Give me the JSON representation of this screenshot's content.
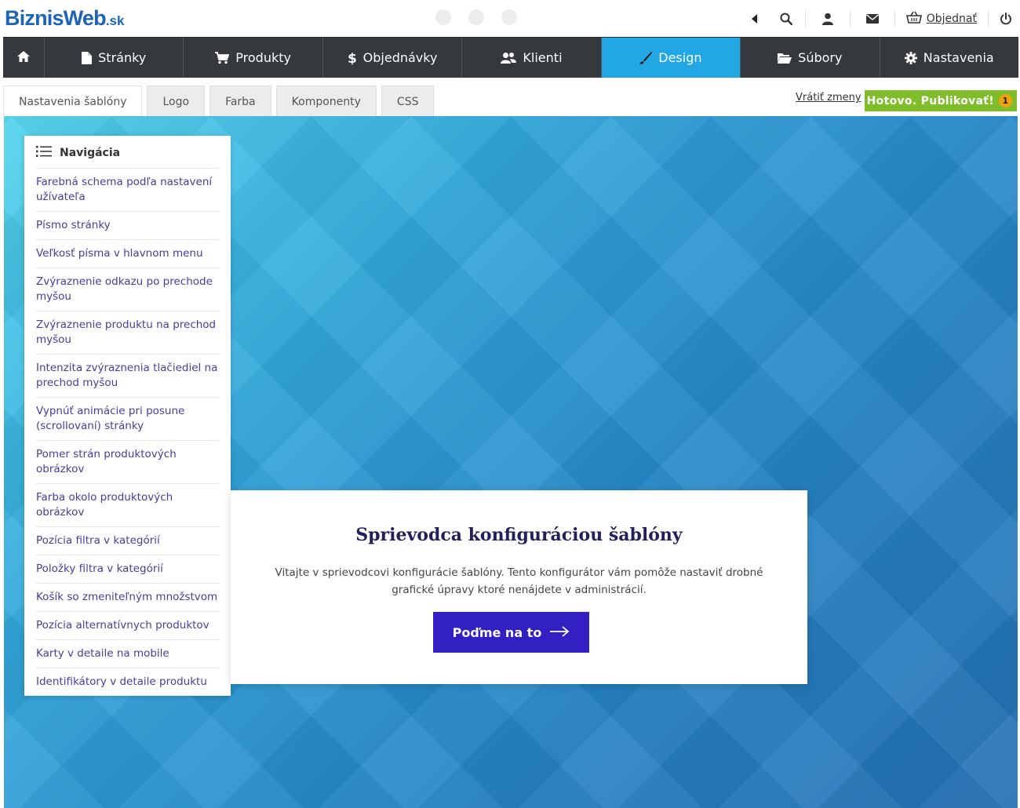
{
  "brand": {
    "logo_main": "BiznisWeb",
    "logo_suffix": ".sk",
    "color": "#1e64b4"
  },
  "topbar": {
    "icons": [
      "caret-left-icon",
      "search-icon",
      "user-icon",
      "mail-icon",
      "basket-icon",
      "power-icon"
    ],
    "order_label": "Objednať"
  },
  "nav": {
    "home_icon": "home-icon",
    "items": [
      {
        "label": "Stránky",
        "icon": "page-icon"
      },
      {
        "label": "Produkty",
        "icon": "cart-icon"
      },
      {
        "label": "Objednávky",
        "icon": "dollar-icon"
      },
      {
        "label": "Klienti",
        "icon": "users-icon"
      },
      {
        "label": "Design",
        "icon": "brush-icon",
        "active": true
      },
      {
        "label": "Súbory",
        "icon": "folder-icon"
      },
      {
        "label": "Nastavenia",
        "icon": "gear-icon"
      }
    ],
    "active_color": "#21a7e3",
    "bg_color": "#35383c"
  },
  "subtabs": {
    "tabs": [
      "Nastavenia šablóny",
      "Logo",
      "Farba",
      "Komponenty",
      "CSS"
    ],
    "active_index": 0,
    "revert_label": "Vrátiť zmeny",
    "publish_label": "Hotovo. Publikovať!",
    "publish_badge": "1",
    "publish_color": "#7fbd2b"
  },
  "sidenav": {
    "title": "Navigácia",
    "items": [
      "Farebná schema podľa nastavení užívateľa",
      "Písmo stránky",
      "Veľkosť písma v hlavnom menu",
      "Zvýraznenie odkazu po prechode myšou",
      "Zvýraznenie produktu na prechod myšou",
      "Intenzita zvýraznenia tlačiediel na prechod myšou",
      "Vypnúť animácie pri posune (scrollovaní) stránky",
      "Pomer strán produktových obrázkov",
      "Farba okolo produktových obrázkov",
      "Pozícia filtra v kategórií",
      "Položky filtra v kategórií",
      "Košík so zmeniteľným množstvom",
      "Pozícia alternatívnych produktov",
      "Karty v detaile na mobile",
      "Identifikátory v detaile produktu"
    ],
    "link_color": "#4b3b9e"
  },
  "wizard": {
    "title": "Sprievodca konfiguráciou šablóny",
    "description": "Vitajte v sprievodcovi konfigurácie šablóny. Tento konfigurátor vám pomôže nastaviť drobné grafické úpravy ktoré nenájdete v administrácií.",
    "cta_label": "Poďme na to",
    "cta_color": "#3320c2"
  }
}
